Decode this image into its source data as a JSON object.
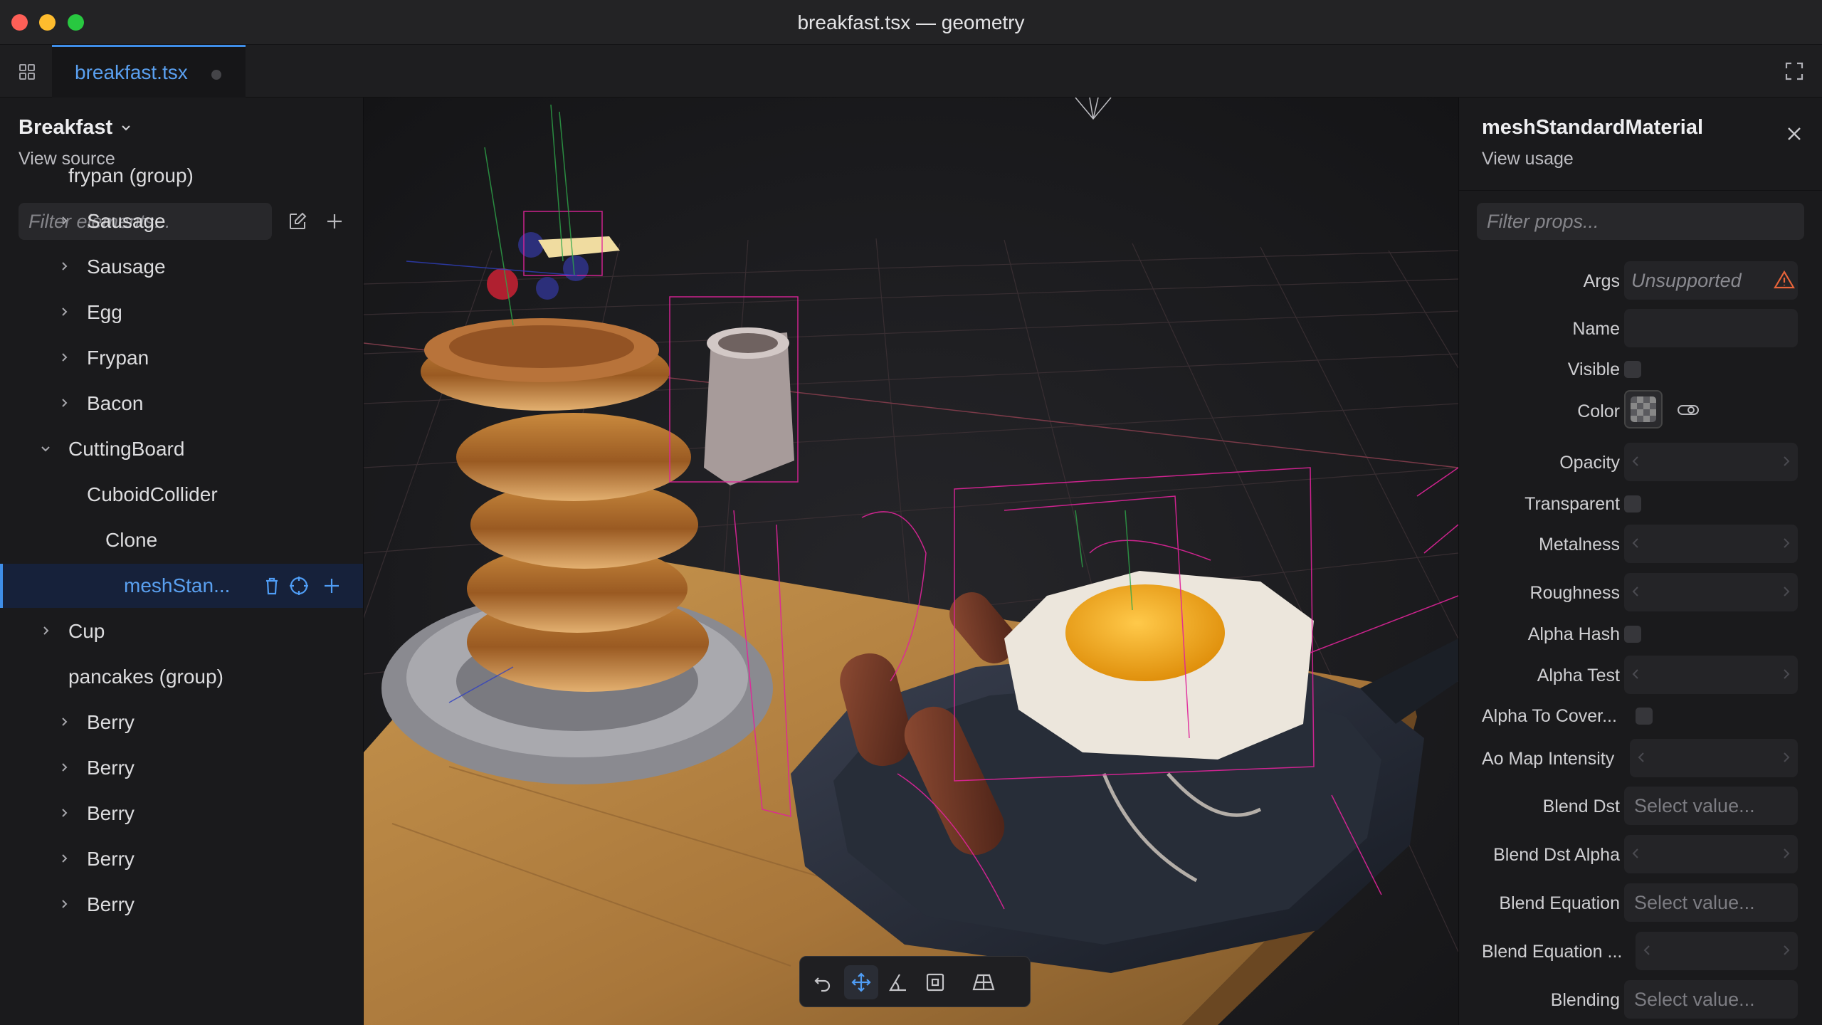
{
  "window": {
    "title": "breakfast.tsx — geometry"
  },
  "tabs": [
    {
      "label": "breakfast.tsx",
      "active": true
    }
  ],
  "scene_panel": {
    "title": "Breakfast",
    "view_source": "View source",
    "filter_placeholder": "Filter elements...",
    "tree": [
      {
        "label": "frypan (group)",
        "depth": 1,
        "expandable": false
      },
      {
        "label": "Sausage",
        "depth": 2,
        "expandable": true,
        "expanded": false
      },
      {
        "label": "Sausage",
        "depth": 2,
        "expandable": true,
        "expanded": false
      },
      {
        "label": "Egg",
        "depth": 2,
        "expandable": true,
        "expanded": false
      },
      {
        "label": "Frypan",
        "depth": 2,
        "expandable": true,
        "expanded": false
      },
      {
        "label": "Bacon",
        "depth": 2,
        "expandable": true,
        "expanded": false
      },
      {
        "label": "CuttingBoard",
        "depth": 1,
        "expandable": true,
        "expanded": true
      },
      {
        "label": "CuboidCollider",
        "depth": 2,
        "expandable": false
      },
      {
        "label": "Clone",
        "depth": 3,
        "expandable": false
      },
      {
        "label": "meshStan...",
        "depth": 4,
        "expandable": false,
        "selected": true
      },
      {
        "label": "Cup",
        "depth": 1,
        "expandable": true,
        "expanded": false
      },
      {
        "label": "pancakes (group)",
        "depth": 1,
        "expandable": false
      },
      {
        "label": "Berry",
        "depth": 2,
        "expandable": true,
        "expanded": false
      },
      {
        "label": "Berry",
        "depth": 2,
        "expandable": true,
        "expanded": false
      },
      {
        "label": "Berry",
        "depth": 2,
        "expandable": true,
        "expanded": false
      },
      {
        "label": "Berry",
        "depth": 2,
        "expandable": true,
        "expanded": false
      },
      {
        "label": "Berry",
        "depth": 2,
        "expandable": true,
        "expanded": false
      }
    ]
  },
  "viewport": {
    "toolbar": [
      {
        "name": "undo-tool",
        "icon": "undo-icon",
        "active": false
      },
      {
        "name": "translate-tool",
        "icon": "move-icon",
        "active": true
      },
      {
        "name": "rotate-tool",
        "icon": "angle-icon",
        "active": false
      },
      {
        "name": "scale-tool",
        "icon": "scale-icon",
        "active": false
      },
      {
        "name": "grid-tool",
        "icon": "grid-plane-icon",
        "active": false
      }
    ]
  },
  "props_panel": {
    "title": "meshStandardMaterial",
    "view_usage": "View usage",
    "filter_placeholder": "Filter props...",
    "props": [
      {
        "label": "Args",
        "type": "unsupported",
        "value": "Unsupported"
      },
      {
        "label": "Name",
        "type": "text",
        "value": ""
      },
      {
        "label": "Visible",
        "type": "checkbox",
        "value": false
      },
      {
        "label": "Color",
        "type": "color",
        "value": ""
      },
      {
        "label": "Opacity",
        "type": "number",
        "value": ""
      },
      {
        "label": "Transparent",
        "type": "checkbox",
        "value": false
      },
      {
        "label": "Metalness",
        "type": "number",
        "value": ""
      },
      {
        "label": "Roughness",
        "type": "number",
        "value": ""
      },
      {
        "label": "Alpha Hash",
        "type": "checkbox",
        "value": false
      },
      {
        "label": "Alpha Test",
        "type": "number",
        "value": ""
      },
      {
        "label": "Alpha To Cover...",
        "type": "checkbox",
        "value": false
      },
      {
        "label": "Ao Map Intensity",
        "type": "number",
        "value": ""
      },
      {
        "label": "Blend Dst",
        "type": "select",
        "value": "Select value..."
      },
      {
        "label": "Blend Dst Alpha",
        "type": "number",
        "value": ""
      },
      {
        "label": "Blend Equation",
        "type": "select",
        "value": "Select value..."
      },
      {
        "label": "Blend Equation ...",
        "type": "number",
        "value": ""
      },
      {
        "label": "Blending",
        "type": "select",
        "value": "Select value..."
      }
    ]
  },
  "colors": {
    "accent": "#3f8ee8",
    "wireframe": "#e0249a",
    "warning": "#e8643a"
  }
}
